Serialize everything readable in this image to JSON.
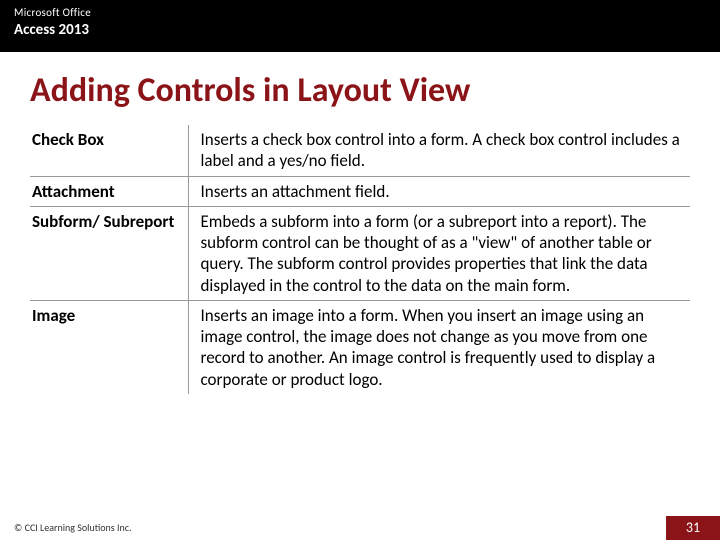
{
  "header": {
    "line1": "Microsoft Office",
    "line2": "Access 2013"
  },
  "title": "Adding Controls in Layout View",
  "rows": [
    {
      "label": "Check Box",
      "description": "Inserts a check box control into a form. A check box control includes a label and a yes/no field."
    },
    {
      "label": "Attachment",
      "description": "Inserts an attachment field."
    },
    {
      "label": "Subform/ Subreport",
      "description": "Embeds a subform into a form (or a subreport into a report). The subform control can be thought of as a \"view\" of another table or query. The subform control provides properties that link the data displayed in the control to the data on the main form."
    },
    {
      "label": "Image",
      "description": "Inserts an image into a form. When you insert an image using an image control, the image does not change as you move from one record to another. An image control is frequently used to display a corporate or product logo."
    }
  ],
  "footer": {
    "copyright": "© CCI Learning Solutions Inc.",
    "pageNumber": "31"
  }
}
